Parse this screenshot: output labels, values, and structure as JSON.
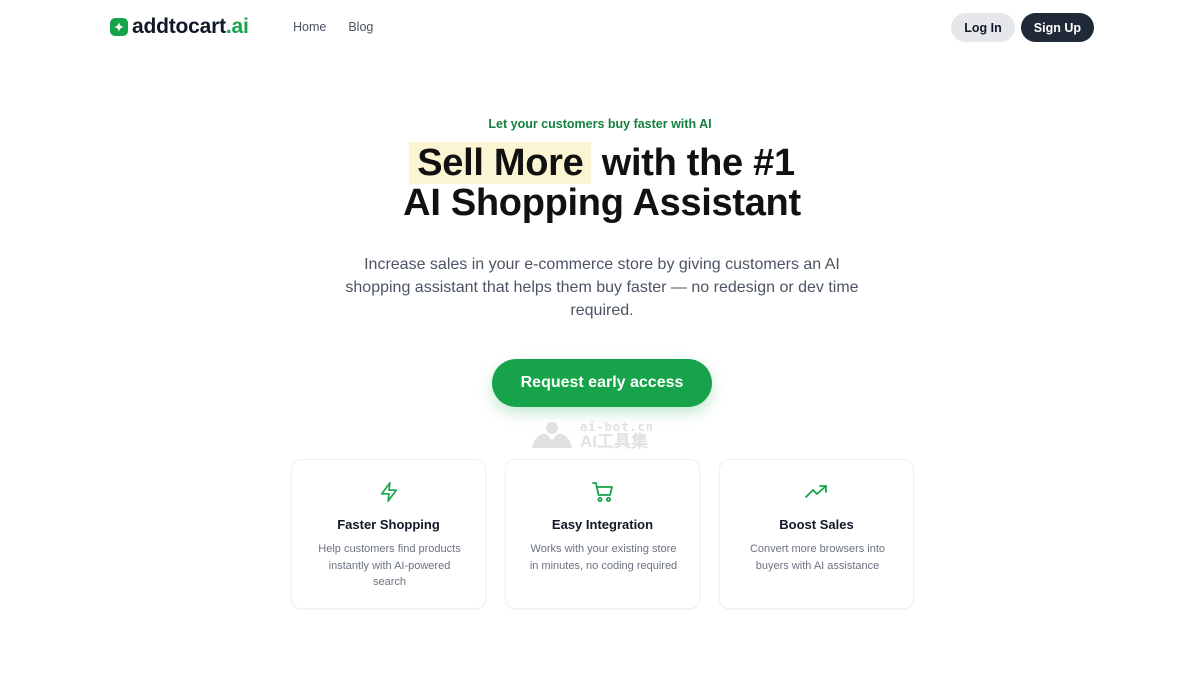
{
  "header": {
    "logo": {
      "name": "addtocart",
      "suffix": ".ai",
      "icon": "sparkle-icon"
    },
    "nav": [
      {
        "label": "Home"
      },
      {
        "label": "Blog"
      }
    ],
    "login_label": "Log In",
    "signup_label": "Sign Up"
  },
  "hero": {
    "eyebrow": "Let your customers buy faster with AI",
    "headline_highlight": "Sell More",
    "headline_rest": " with the #1",
    "headline_line2": "AI Shopping Assistant",
    "subtitle": "Increase sales in your e-commerce store by giving customers an AI shopping assistant that helps them buy faster — no redesign or dev time required.",
    "cta_label": "Request early access"
  },
  "watermark": {
    "domain": "ai-bot.cn",
    "name": "AI工具集"
  },
  "features": [
    {
      "icon": "lightning-icon",
      "title": "Faster Shopping",
      "desc": "Help customers find products instantly with AI-powered search"
    },
    {
      "icon": "shopping-cart-icon",
      "title": "Easy Integration",
      "desc": "Works with your existing store in minutes, no coding required"
    },
    {
      "icon": "trending-up-icon",
      "title": "Boost Sales",
      "desc": "Convert more browsers into buyers with AI assistance"
    }
  ],
  "colors": {
    "brand_green": "#16a34a",
    "eyebrow_green": "#15803d",
    "highlight": "#fbf5d3",
    "dark_button": "#1f2937"
  }
}
